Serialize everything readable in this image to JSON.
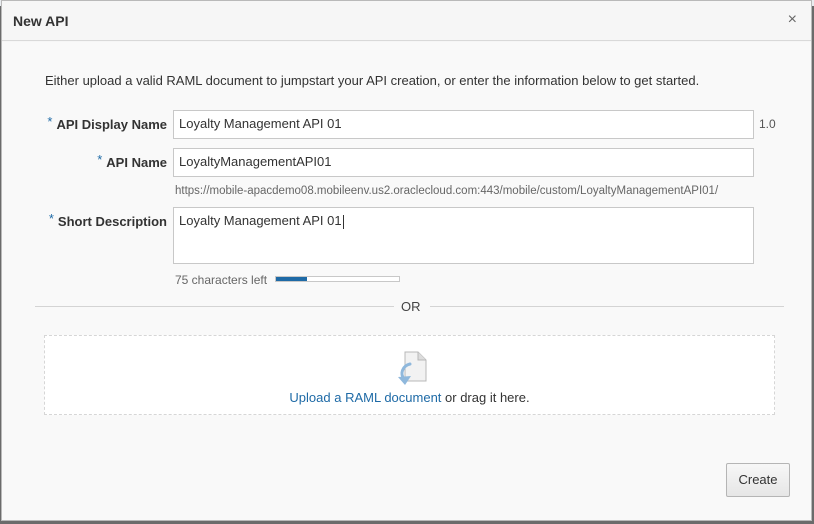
{
  "dialog": {
    "title": "New API",
    "close_icon": "×"
  },
  "intro": "Either upload a valid RAML document to jumpstart your API creation, or enter the information below to get started.",
  "form": {
    "display_name": {
      "required_marker": "*",
      "label": "API Display Name",
      "value": "Loyalty Management API 01",
      "version": "1.0"
    },
    "api_name": {
      "required_marker": "*",
      "label": "API Name",
      "value": "LoyaltyManagementAPI01",
      "url": "https://mobile-apacdemo08.mobileenv.us2.oraclecloud.com:443/mobile/custom/LoyaltyManagementAPI01/"
    },
    "short_description": {
      "required_marker": "*",
      "label": "Short Description",
      "value": "Loyalty Management API 01",
      "chars_left": "75 characters left",
      "used_fraction": 0.25
    }
  },
  "separator": "OR",
  "upload": {
    "icon": "document-upload-icon",
    "link_text": "Upload a RAML document",
    "suffix": " or drag it here."
  },
  "footer": {
    "create_label": "Create"
  },
  "colors": {
    "accent": "#1e6aa6"
  }
}
